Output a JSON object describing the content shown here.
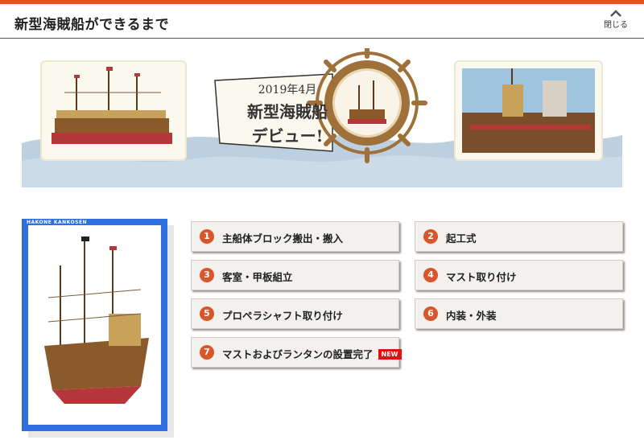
{
  "header": {
    "title": "新型海賊船ができるまで",
    "close_label": "閉じる"
  },
  "banner": {
    "debut_year": "2019年4月",
    "debut_name": "新型海賊船",
    "debut_word": "デビュー!"
  },
  "poster": {
    "brand": "HAKONE KANKOSEN"
  },
  "steps": [
    {
      "num": "1",
      "label": "主船体ブロック搬出・搬入"
    },
    {
      "num": "2",
      "label": "起工式"
    },
    {
      "num": "3",
      "label": "客室・甲板組立"
    },
    {
      "num": "4",
      "label": "マスト取り付け"
    },
    {
      "num": "5",
      "label": "プロペラシャフト取り付け"
    },
    {
      "num": "6",
      "label": "内装・外装"
    },
    {
      "num": "7",
      "label": "マストおよびランタンの設置完了",
      "badge": "NEW"
    }
  ],
  "colors": {
    "accent": "#e2531f",
    "step_number": "#d9552a",
    "poster_frame": "#2f6fe0",
    "new_badge": "#e01010"
  }
}
